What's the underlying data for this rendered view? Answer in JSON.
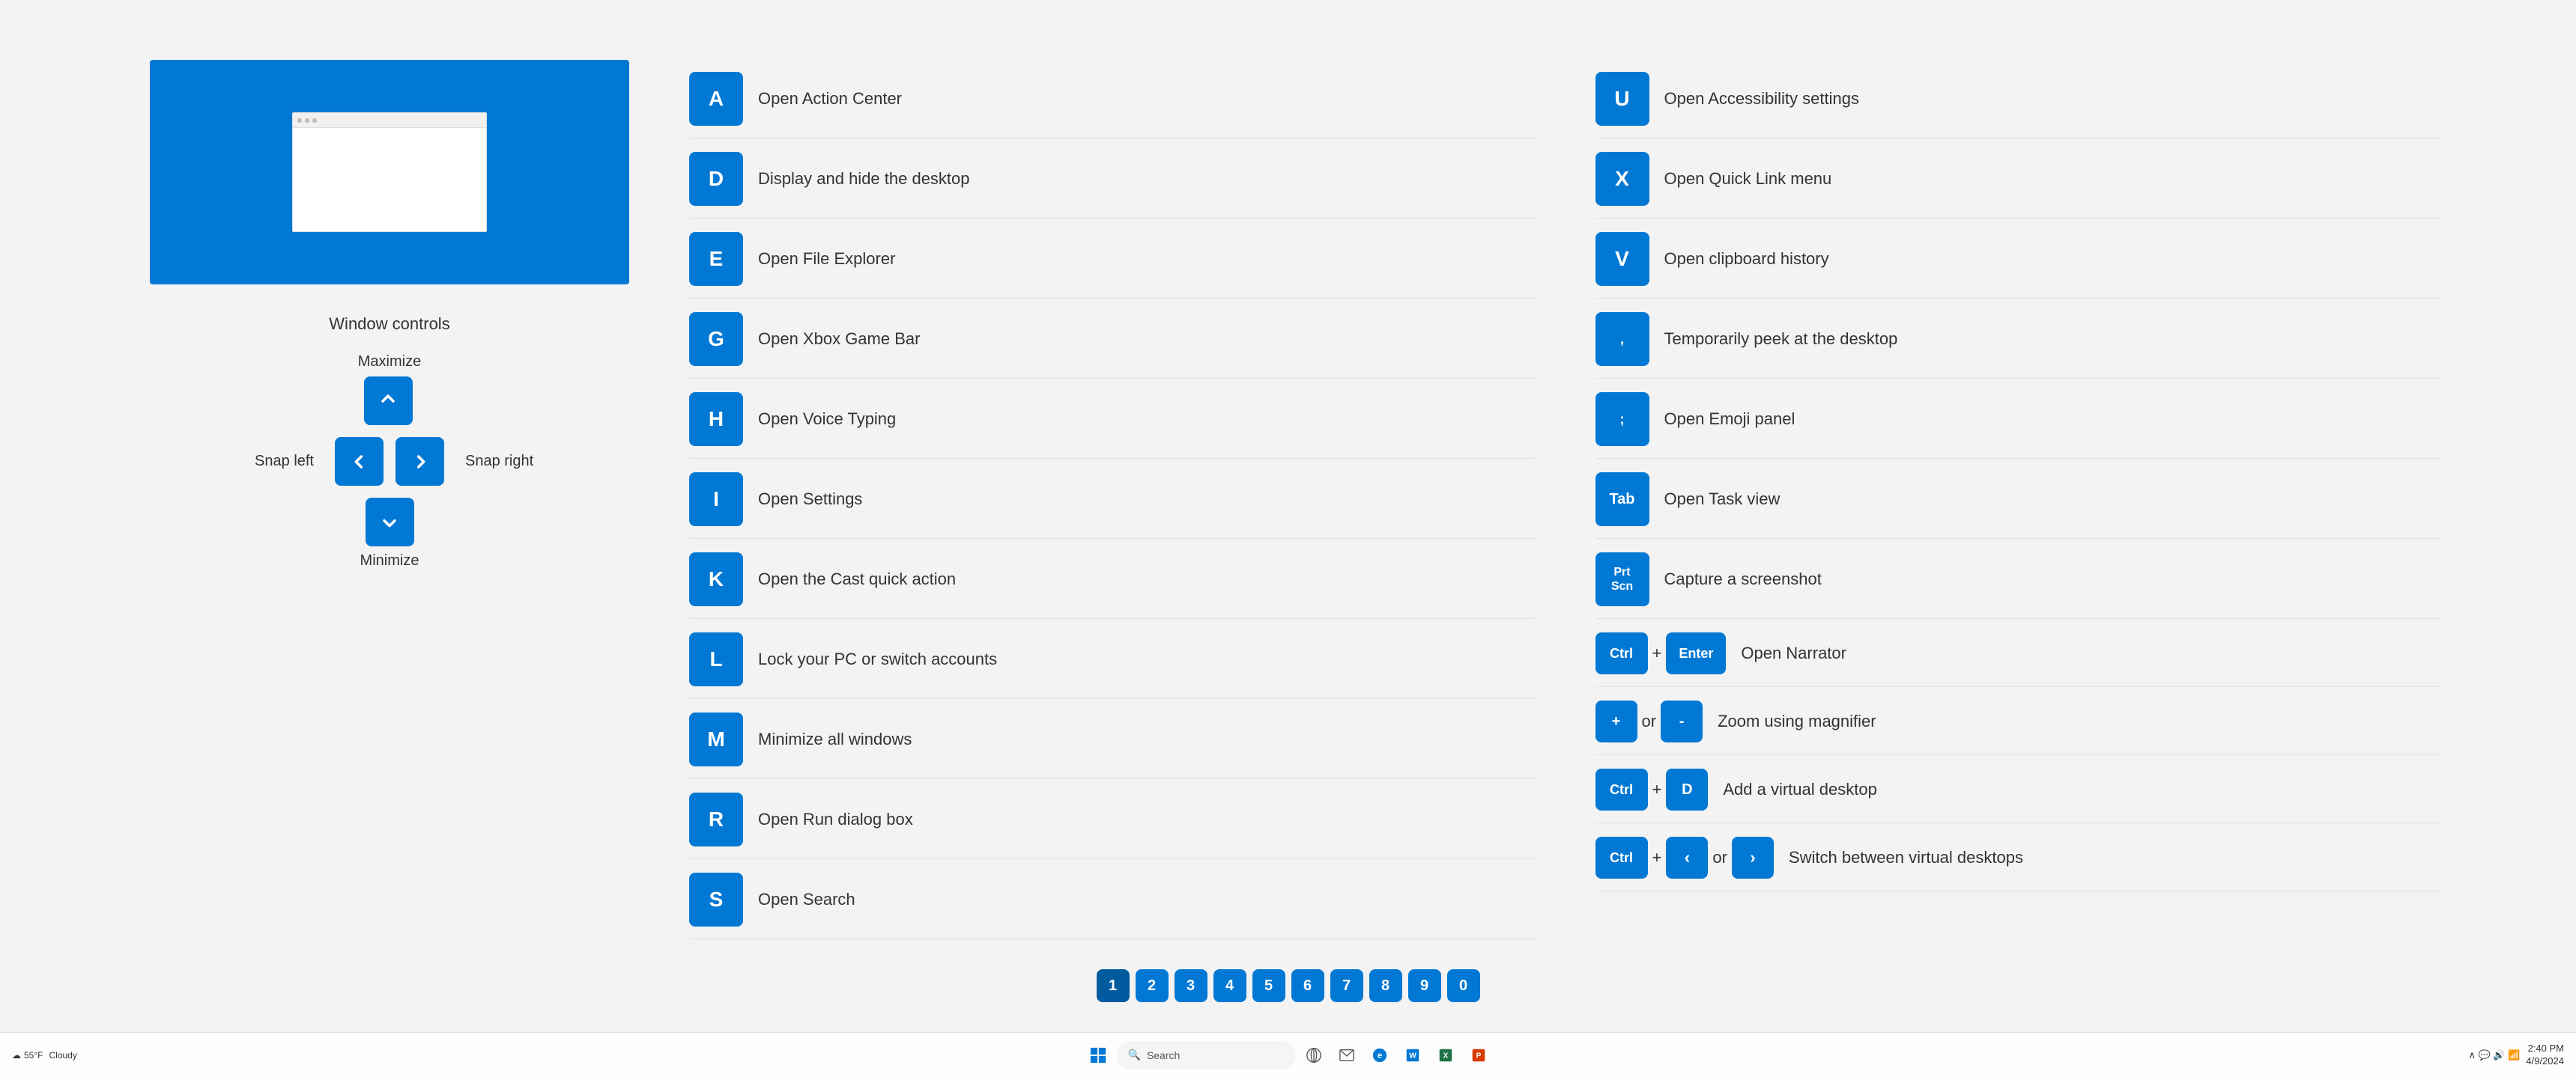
{
  "left_panel": {
    "controls_title": "Window controls",
    "maximize_label": "Maximize",
    "snap_left_label": "Snap left",
    "snap_right_label": "Snap right",
    "minimize_label": "Minimize"
  },
  "shortcuts_left": [
    {
      "key": "A",
      "desc": "Open Action Center"
    },
    {
      "key": "D",
      "desc": "Display and hide the desktop"
    },
    {
      "key": "E",
      "desc": "Open File Explorer"
    },
    {
      "key": "G",
      "desc": "Open Xbox Game Bar"
    },
    {
      "key": "H",
      "desc": "Open Voice Typing"
    },
    {
      "key": "I",
      "desc": "Open Settings"
    },
    {
      "key": "K",
      "desc": "Open the Cast quick action"
    },
    {
      "key": "L",
      "desc": "Lock your PC or switch accounts"
    },
    {
      "key": "M",
      "desc": "Minimize all windows"
    },
    {
      "key": "R",
      "desc": "Open Run dialog box"
    },
    {
      "key": "S",
      "desc": "Open Search"
    }
  ],
  "shortcuts_right": [
    {
      "key": "U",
      "desc": "Open Accessibility settings",
      "combo": null
    },
    {
      "key": "X",
      "desc": "Open Quick Link menu",
      "combo": null
    },
    {
      "key": "V",
      "desc": "Open clipboard history",
      "combo": null
    },
    {
      "key": ",",
      "desc": "Temporarily peek at the desktop",
      "combo": null
    },
    {
      "key": ";",
      "desc": "Open Emoji panel",
      "combo": null
    },
    {
      "key": "Tab",
      "desc": "Open Task view",
      "combo": null
    },
    {
      "key": "PrtScn",
      "desc": "Capture a screenshot",
      "combo": null
    },
    {
      "key": "Ctrl",
      "plus": "+",
      "key2": "Enter",
      "desc": "Open Narrator",
      "type": "combo"
    },
    {
      "key": "+",
      "or": "or",
      "key2": "-",
      "desc": "Zoom using magnifier",
      "type": "plus_minus"
    },
    {
      "key": "Ctrl",
      "plus": "+",
      "key2": "D",
      "desc": "Add a virtual desktop",
      "type": "combo"
    },
    {
      "key": "Ctrl",
      "plus": "+",
      "key2_arr": [
        "<",
        ">"
      ],
      "or": "or",
      "desc": "Switch between virtual desktops",
      "type": "combo_arrows"
    }
  ],
  "pagination": {
    "pages": [
      "1",
      "2",
      "3",
      "4",
      "5",
      "6",
      "7",
      "8",
      "9",
      "0"
    ],
    "active": 0
  },
  "taskbar": {
    "weather": "55°F",
    "weather_desc": "Cloudy",
    "search_placeholder": "Search",
    "time": "2:40 PM",
    "date": "4/9/2024"
  }
}
